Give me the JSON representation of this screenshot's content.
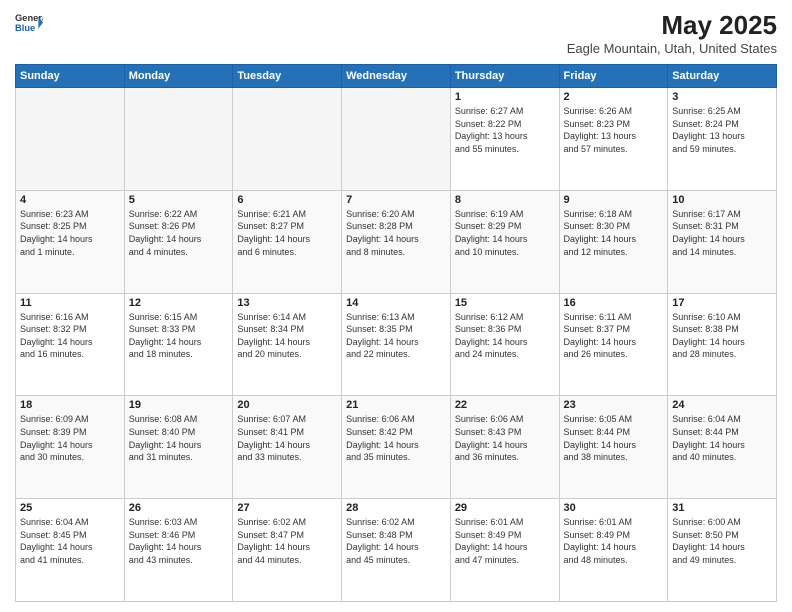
{
  "header": {
    "logo_line1": "General",
    "logo_line2": "Blue",
    "title": "May 2025",
    "subtitle": "Eagle Mountain, Utah, United States"
  },
  "days_of_week": [
    "Sunday",
    "Monday",
    "Tuesday",
    "Wednesday",
    "Thursday",
    "Friday",
    "Saturday"
  ],
  "weeks": [
    [
      {
        "day": "",
        "info": ""
      },
      {
        "day": "",
        "info": ""
      },
      {
        "day": "",
        "info": ""
      },
      {
        "day": "",
        "info": ""
      },
      {
        "day": "1",
        "info": "Sunrise: 6:27 AM\nSunset: 8:22 PM\nDaylight: 13 hours\nand 55 minutes."
      },
      {
        "day": "2",
        "info": "Sunrise: 6:26 AM\nSunset: 8:23 PM\nDaylight: 13 hours\nand 57 minutes."
      },
      {
        "day": "3",
        "info": "Sunrise: 6:25 AM\nSunset: 8:24 PM\nDaylight: 13 hours\nand 59 minutes."
      }
    ],
    [
      {
        "day": "4",
        "info": "Sunrise: 6:23 AM\nSunset: 8:25 PM\nDaylight: 14 hours\nand 1 minute."
      },
      {
        "day": "5",
        "info": "Sunrise: 6:22 AM\nSunset: 8:26 PM\nDaylight: 14 hours\nand 4 minutes."
      },
      {
        "day": "6",
        "info": "Sunrise: 6:21 AM\nSunset: 8:27 PM\nDaylight: 14 hours\nand 6 minutes."
      },
      {
        "day": "7",
        "info": "Sunrise: 6:20 AM\nSunset: 8:28 PM\nDaylight: 14 hours\nand 8 minutes."
      },
      {
        "day": "8",
        "info": "Sunrise: 6:19 AM\nSunset: 8:29 PM\nDaylight: 14 hours\nand 10 minutes."
      },
      {
        "day": "9",
        "info": "Sunrise: 6:18 AM\nSunset: 8:30 PM\nDaylight: 14 hours\nand 12 minutes."
      },
      {
        "day": "10",
        "info": "Sunrise: 6:17 AM\nSunset: 8:31 PM\nDaylight: 14 hours\nand 14 minutes."
      }
    ],
    [
      {
        "day": "11",
        "info": "Sunrise: 6:16 AM\nSunset: 8:32 PM\nDaylight: 14 hours\nand 16 minutes."
      },
      {
        "day": "12",
        "info": "Sunrise: 6:15 AM\nSunset: 8:33 PM\nDaylight: 14 hours\nand 18 minutes."
      },
      {
        "day": "13",
        "info": "Sunrise: 6:14 AM\nSunset: 8:34 PM\nDaylight: 14 hours\nand 20 minutes."
      },
      {
        "day": "14",
        "info": "Sunrise: 6:13 AM\nSunset: 8:35 PM\nDaylight: 14 hours\nand 22 minutes."
      },
      {
        "day": "15",
        "info": "Sunrise: 6:12 AM\nSunset: 8:36 PM\nDaylight: 14 hours\nand 24 minutes."
      },
      {
        "day": "16",
        "info": "Sunrise: 6:11 AM\nSunset: 8:37 PM\nDaylight: 14 hours\nand 26 minutes."
      },
      {
        "day": "17",
        "info": "Sunrise: 6:10 AM\nSunset: 8:38 PM\nDaylight: 14 hours\nand 28 minutes."
      }
    ],
    [
      {
        "day": "18",
        "info": "Sunrise: 6:09 AM\nSunset: 8:39 PM\nDaylight: 14 hours\nand 30 minutes."
      },
      {
        "day": "19",
        "info": "Sunrise: 6:08 AM\nSunset: 8:40 PM\nDaylight: 14 hours\nand 31 minutes."
      },
      {
        "day": "20",
        "info": "Sunrise: 6:07 AM\nSunset: 8:41 PM\nDaylight: 14 hours\nand 33 minutes."
      },
      {
        "day": "21",
        "info": "Sunrise: 6:06 AM\nSunset: 8:42 PM\nDaylight: 14 hours\nand 35 minutes."
      },
      {
        "day": "22",
        "info": "Sunrise: 6:06 AM\nSunset: 8:43 PM\nDaylight: 14 hours\nand 36 minutes."
      },
      {
        "day": "23",
        "info": "Sunrise: 6:05 AM\nSunset: 8:44 PM\nDaylight: 14 hours\nand 38 minutes."
      },
      {
        "day": "24",
        "info": "Sunrise: 6:04 AM\nSunset: 8:44 PM\nDaylight: 14 hours\nand 40 minutes."
      }
    ],
    [
      {
        "day": "25",
        "info": "Sunrise: 6:04 AM\nSunset: 8:45 PM\nDaylight: 14 hours\nand 41 minutes."
      },
      {
        "day": "26",
        "info": "Sunrise: 6:03 AM\nSunset: 8:46 PM\nDaylight: 14 hours\nand 43 minutes."
      },
      {
        "day": "27",
        "info": "Sunrise: 6:02 AM\nSunset: 8:47 PM\nDaylight: 14 hours\nand 44 minutes."
      },
      {
        "day": "28",
        "info": "Sunrise: 6:02 AM\nSunset: 8:48 PM\nDaylight: 14 hours\nand 45 minutes."
      },
      {
        "day": "29",
        "info": "Sunrise: 6:01 AM\nSunset: 8:49 PM\nDaylight: 14 hours\nand 47 minutes."
      },
      {
        "day": "30",
        "info": "Sunrise: 6:01 AM\nSunset: 8:49 PM\nDaylight: 14 hours\nand 48 minutes."
      },
      {
        "day": "31",
        "info": "Sunrise: 6:00 AM\nSunset: 8:50 PM\nDaylight: 14 hours\nand 49 minutes."
      }
    ]
  ]
}
